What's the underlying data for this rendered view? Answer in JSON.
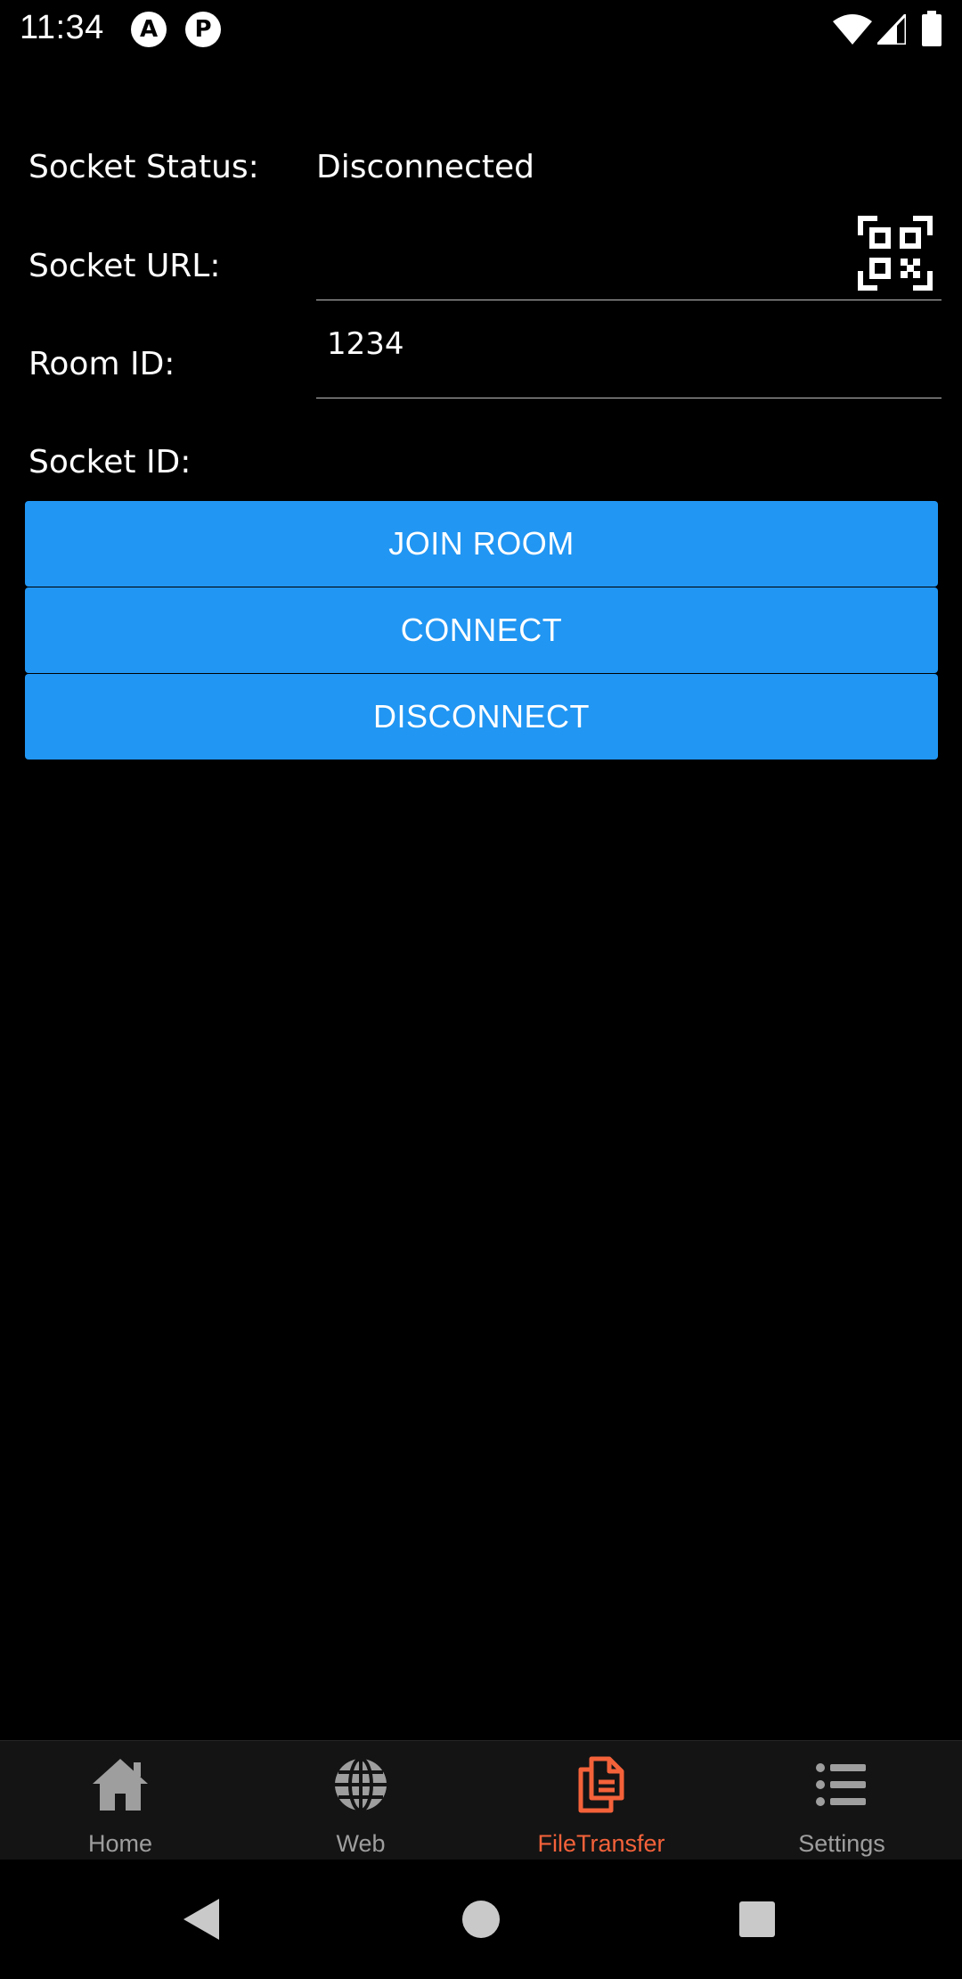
{
  "status_bar": {
    "time": "11:34",
    "app_icons": [
      "A",
      "P"
    ]
  },
  "form": {
    "socket_status_label": "Socket Status:",
    "socket_status_value": "Disconnected",
    "socket_url_label": "Socket URL:",
    "socket_url_value": "",
    "room_id_label": "Room ID:",
    "room_id_value": "1234",
    "socket_id_label": "Socket ID:",
    "socket_id_value": ""
  },
  "buttons": {
    "join_room": "JOIN ROOM",
    "connect": "CONNECT",
    "disconnect": "DISCONNECT"
  },
  "bottom_nav": {
    "items": [
      {
        "label": "Home",
        "icon": "home-icon",
        "active": false
      },
      {
        "label": "Web",
        "icon": "globe-icon",
        "active": false
      },
      {
        "label": "FileTransfer",
        "icon": "file-copy-icon",
        "active": true
      },
      {
        "label": "Settings",
        "icon": "list-icon",
        "active": false
      }
    ]
  },
  "colors": {
    "background": "#000000",
    "button": "#2196f3",
    "active_tab": "#f4623a",
    "inactive_tab": "#9e9e9e",
    "nav_background": "#141414"
  }
}
